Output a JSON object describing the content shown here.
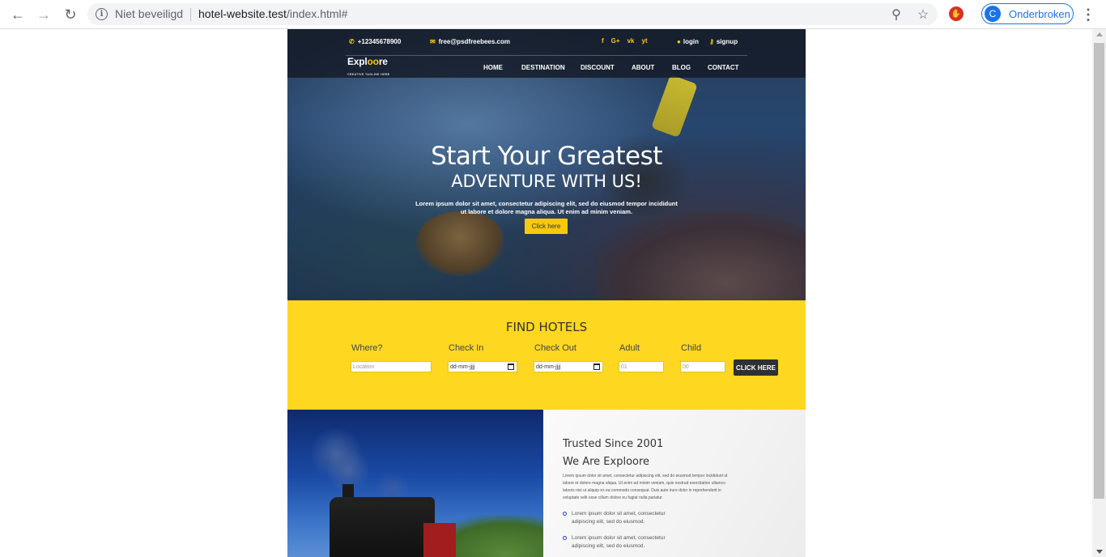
{
  "browser": {
    "security_label": "Niet beveiligd",
    "url_host": "hotel-website.test",
    "url_path": "/index.html#",
    "profile_initial": "C",
    "profile_label": "Onderbroken"
  },
  "site": {
    "phone": "+12345678900",
    "email": "free@psdfreebees.com",
    "social": [
      "f",
      "G+",
      "vk",
      "yt"
    ],
    "login": "login",
    "signup": "signup",
    "logo_a": "Expl",
    "logo_b": "oo",
    "logo_c": "re",
    "tagline": "CREATIVE TAGLINE HERE",
    "menu": [
      "HOME",
      "DESTINATION",
      "DISCOUNT",
      "ABOUT",
      "BLOG",
      "CONTACT"
    ]
  },
  "hero": {
    "title": "Start Your Greatest",
    "subtitle": "ADVENTURE WITH US!",
    "text": "Lorem ipsum dolor sit amet, consectetur adipiscing elit, sed do eiusmod tempor incididunt ut labore et dolore magna aliqua. Ut enim ad minim veniam.",
    "button": "Click here"
  },
  "find_hotels": {
    "title": "FIND HOTELS",
    "labels": [
      "Where?",
      "Check In",
      "Check Out",
      "Adult",
      "Child"
    ],
    "where_placeholder": "Location",
    "checkin_placeholder": "dd-mm-jjjj",
    "checkout_placeholder": "dd-mm-jjjj",
    "adult_placeholder": "01",
    "child_placeholder": "00",
    "button": "CLICK HERE"
  },
  "about": {
    "title1": "Trusted Since 2001",
    "title2": "We Are Exploore",
    "text": "Lorem ipsum dolor sit amet, consectetur adipiscing elit, sed do eiusmod tempor incididunt ut labore et dolore magna aliqua. Ut enim ad minim veniam, quis nostrud exercitation ullamco laboris nisi ut aliquip ex ea commodo consequat. Duis aute irure dolor in reprehenderit in voluptate velit esse cillum dolore eu fugiat nulla pariatur.",
    "bullets": [
      "Lorem ipsum dolor sit amet, consectetur adipiscing elit, sed do eiusmod.",
      "Lorem ipsum dolor sit amet, consectetur adipiscing elit, sed do eiusmod."
    ]
  }
}
